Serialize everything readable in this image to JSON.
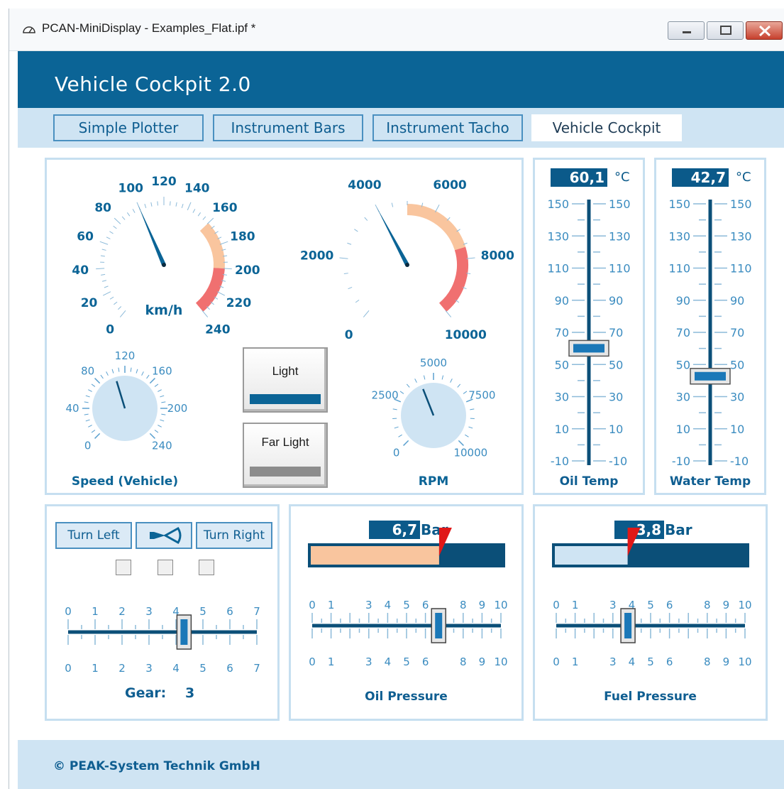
{
  "window": {
    "title": "PCAN-MiniDisplay - Examples_Flat.ipf *",
    "icon": "gauge-icon"
  },
  "banner": {
    "title": "Vehicle Cockpit 2.0"
  },
  "tabs": [
    {
      "label": "Simple Plotter",
      "active": false
    },
    {
      "label": "Instrument Bars",
      "active": false
    },
    {
      "label": "Instrument Tacho",
      "active": false
    },
    {
      "label": "Vehicle Cockpit",
      "active": true
    }
  ],
  "speedometer": {
    "unit": "km/h",
    "min": 0,
    "max": 240,
    "ticks": [
      "0",
      "20",
      "40",
      "60",
      "80",
      "100",
      "120",
      "140",
      "160",
      "180",
      "200",
      "220",
      "240"
    ],
    "value": 100
  },
  "tachometer": {
    "min": 0,
    "max": 10000,
    "ticks": [
      "0",
      "2000",
      "4000",
      "6000",
      "8000",
      "10000"
    ],
    "value": 4000
  },
  "speed_small": {
    "label": "Speed (Vehicle)",
    "ticks": [
      "0",
      "40",
      "80",
      "120",
      "160",
      "200",
      "240"
    ],
    "value": 105
  },
  "rpm_small": {
    "label": "RPM",
    "ticks": [
      "0",
      "2500",
      "5000",
      "7500",
      "10000"
    ],
    "value": 4200
  },
  "buttons": {
    "light": "Light",
    "far_light": "Far Light"
  },
  "oil_temp": {
    "label": "Oil Temp",
    "value": "60,1",
    "unit": "°C",
    "ticks": [
      "150",
      "130",
      "110",
      "90",
      "70",
      "50",
      "30",
      "10",
      "-10"
    ],
    "level": 60.1
  },
  "water_temp": {
    "label": "Water Temp",
    "value": "42,7",
    "unit": "°C",
    "ticks": [
      "150",
      "130",
      "110",
      "90",
      "70",
      "50",
      "30",
      "10",
      "-10"
    ],
    "level": 42.7
  },
  "gear": {
    "turn_left": "Turn Left",
    "turn_right": "Turn Right",
    "horn_icon": "horn-icon",
    "ticks": [
      "0",
      "1",
      "2",
      "3",
      "4",
      "5",
      "6",
      "7"
    ],
    "label": "Gear:",
    "value": "3",
    "slider": 4.3
  },
  "oil_pressure": {
    "label": "Oil Pressure",
    "value": "6,7",
    "unit": "Bar",
    "ticks": [
      "0",
      "1",
      "3",
      "4",
      "5",
      "6",
      "8",
      "9",
      "10"
    ],
    "level": 6.7,
    "max": 10
  },
  "fuel_pressure": {
    "label": "Fuel Pressure",
    "value": "3,8",
    "unit": "Bar",
    "ticks": [
      "0",
      "1",
      "3",
      "4",
      "5",
      "6",
      "8",
      "9",
      "10"
    ],
    "level": 3.8,
    "max": 10
  },
  "footer": {
    "text": "© PEAK-System Technik GmbH"
  },
  "colors": {
    "primary": "#0b6496",
    "light_band": "#cfe4f3",
    "warn": "#f9c59e",
    "danger": "#f07070",
    "needle": "#0b6496"
  }
}
